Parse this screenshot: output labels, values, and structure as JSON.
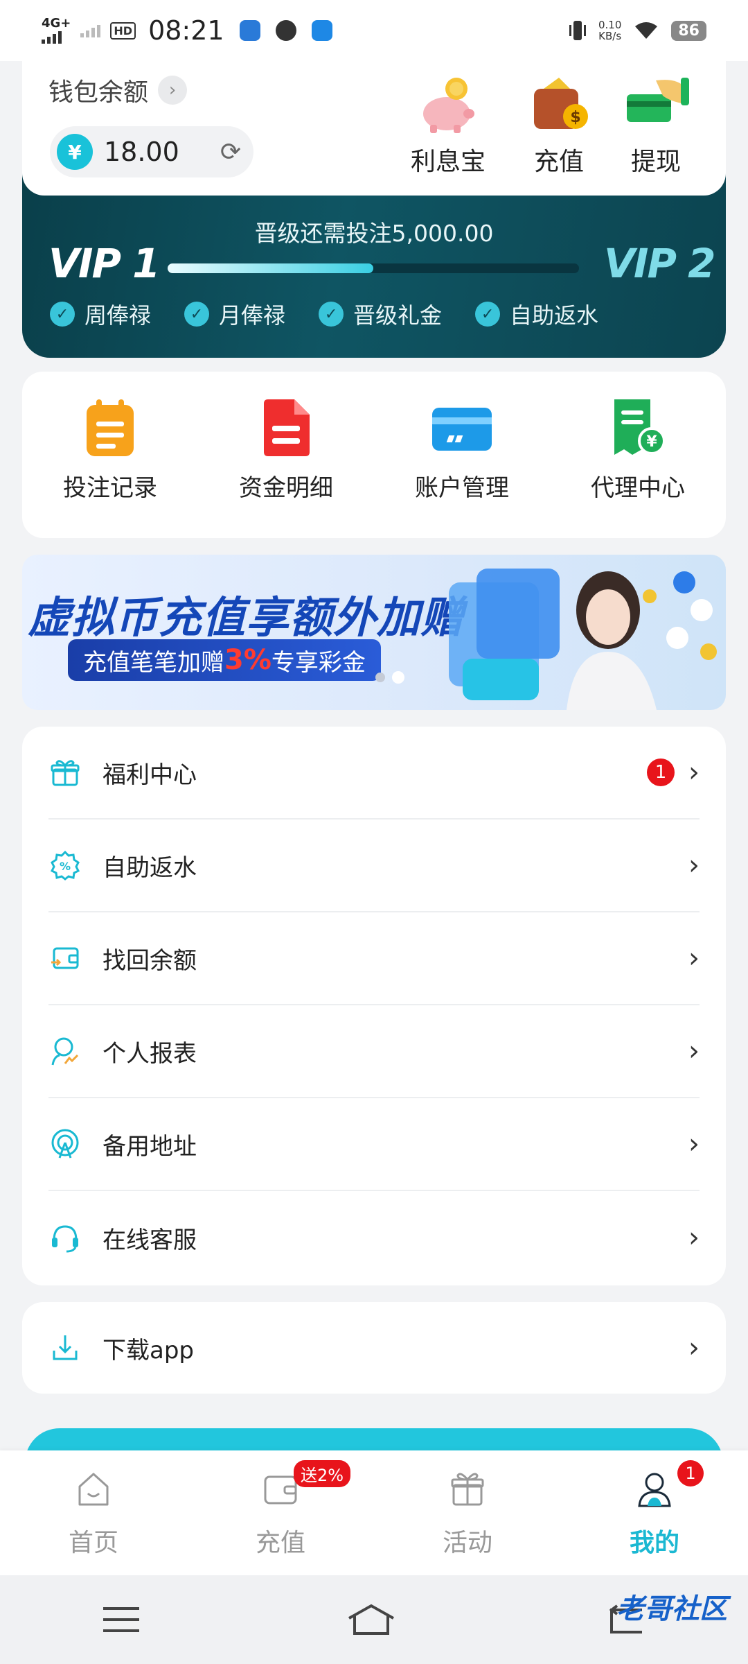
{
  "status_bar": {
    "network": "4G+",
    "hd": "HD",
    "time": "08:21",
    "speed_value": "0.10",
    "speed_unit": "KB/s",
    "battery": "86"
  },
  "wallet": {
    "label": "钱包余额",
    "balance": "18.00",
    "currency_symbol": "¥",
    "actions": [
      {
        "label": "利息宝",
        "icon": "piggy-bank-icon"
      },
      {
        "label": "充值",
        "icon": "wallet-coin-icon"
      },
      {
        "label": "提现",
        "icon": "card-hand-icon"
      }
    ]
  },
  "vip": {
    "upgrade_text": "晋级还需投注5,000.00",
    "current_level": "VIP 1",
    "next_level": "VIP 2",
    "progress_fraction": 0.5,
    "perks": [
      "周俸禄",
      "月俸禄",
      "晋级礼金",
      "自助返水"
    ]
  },
  "functions": [
    {
      "label": "投注记录",
      "icon": "bet-record-icon"
    },
    {
      "label": "资金明细",
      "icon": "fund-detail-icon"
    },
    {
      "label": "账户管理",
      "icon": "card-icon"
    },
    {
      "label": "代理中心",
      "icon": "agent-receipt-icon"
    }
  ],
  "promo": {
    "title": "虚拟币充值享额外加赠",
    "sub_prefix": "充值笔笔加赠",
    "sub_highlight": "3%",
    "sub_suffix": "专享彩金",
    "slide_count": 2,
    "active_slide": 2
  },
  "menu": [
    {
      "label": "福利中心",
      "icon": "gift-icon",
      "badge": "1"
    },
    {
      "label": "自助返水",
      "icon": "percent-badge-icon",
      "badge": ""
    },
    {
      "label": "找回余额",
      "icon": "wallet-return-icon",
      "badge": ""
    },
    {
      "label": "个人报表",
      "icon": "user-report-icon",
      "badge": ""
    },
    {
      "label": "备用地址",
      "icon": "signal-tower-icon",
      "badge": ""
    },
    {
      "label": "在线客服",
      "icon": "headset-icon",
      "badge": ""
    }
  ],
  "download": {
    "label": "下载app",
    "icon": "download-icon"
  },
  "tabs": [
    {
      "label": "首页",
      "icon": "home-icon",
      "active": false
    },
    {
      "label": "充值",
      "icon": "wallet-icon",
      "badge": "送2%",
      "active": false
    },
    {
      "label": "活动",
      "icon": "gift-box-icon",
      "active": false
    },
    {
      "label": "我的",
      "icon": "user-icon",
      "badge": "1",
      "active": true
    }
  ],
  "watermark": "老哥社区",
  "colors": {
    "accent": "#1bb8d2",
    "vip_bg": "#0f5563",
    "badge_red": "#e8141b",
    "promo_blue": "#1447b8"
  }
}
